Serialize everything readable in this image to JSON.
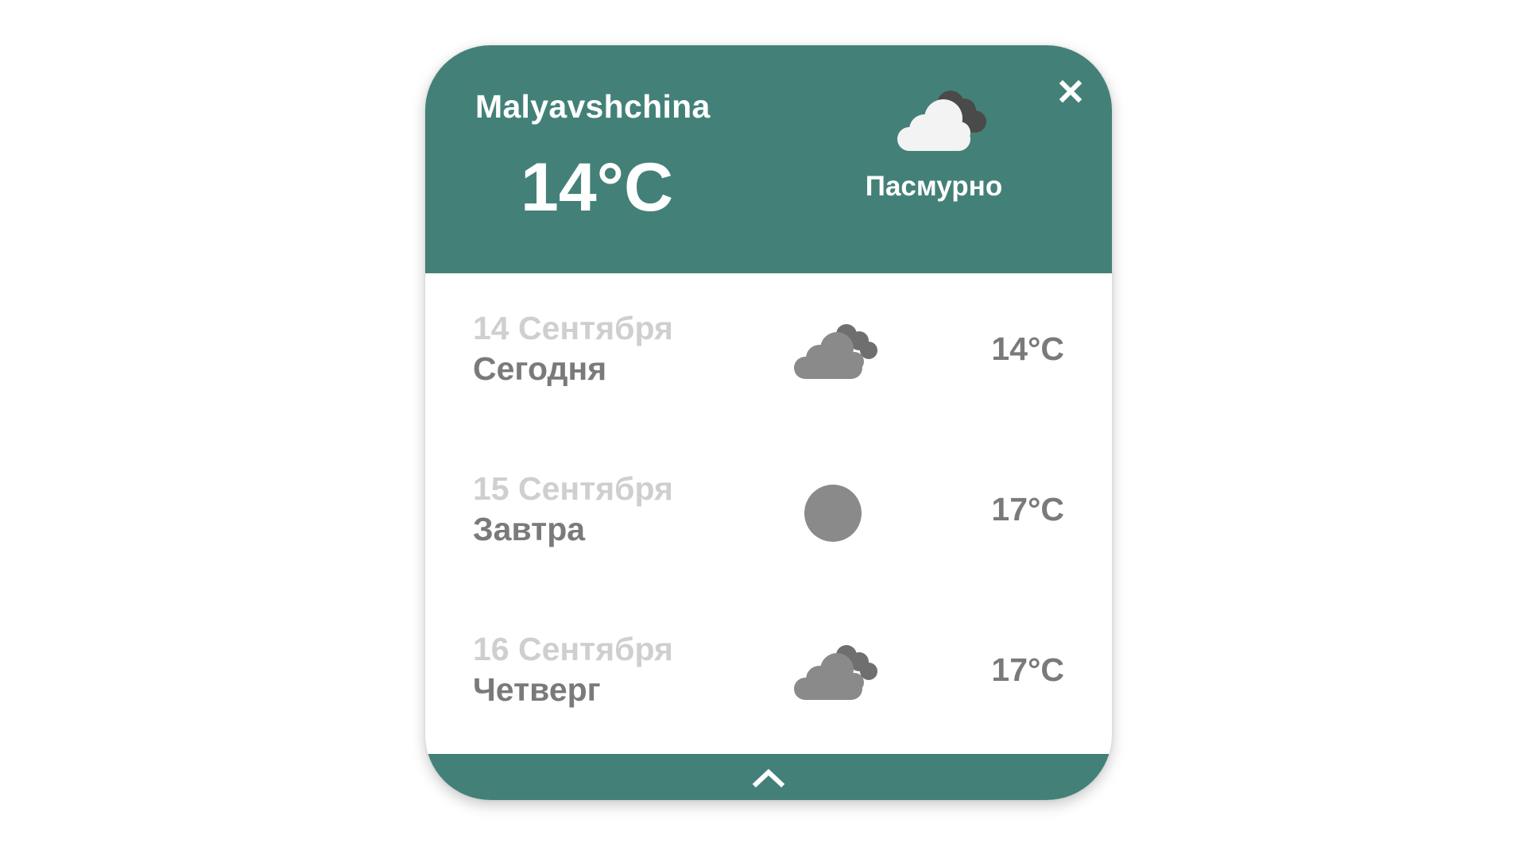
{
  "current": {
    "city": "Malyavshchina",
    "temperature": "14°C",
    "condition": "Пасмурно",
    "icon": "overcast-cloud-icon"
  },
  "forecast": [
    {
      "date": "14 Сентября",
      "day": "Сегодня",
      "temperature": "14°C",
      "icon": "cloud-icon"
    },
    {
      "date": "15 Сентября",
      "day": "Завтра",
      "temperature": "17°C",
      "icon": "sun-icon"
    },
    {
      "date": "16 Сентября",
      "day": "Четверг",
      "temperature": "17°C",
      "icon": "cloud-icon"
    }
  ],
  "controls": {
    "close": "close-icon",
    "collapse": "chevron-up-icon"
  },
  "colors": {
    "accent": "#438178",
    "header_text": "#ffffff",
    "date_text": "#cfcfcf",
    "secondary_text": "#7a7a7a",
    "icon_gray": "#8a8a8a"
  }
}
